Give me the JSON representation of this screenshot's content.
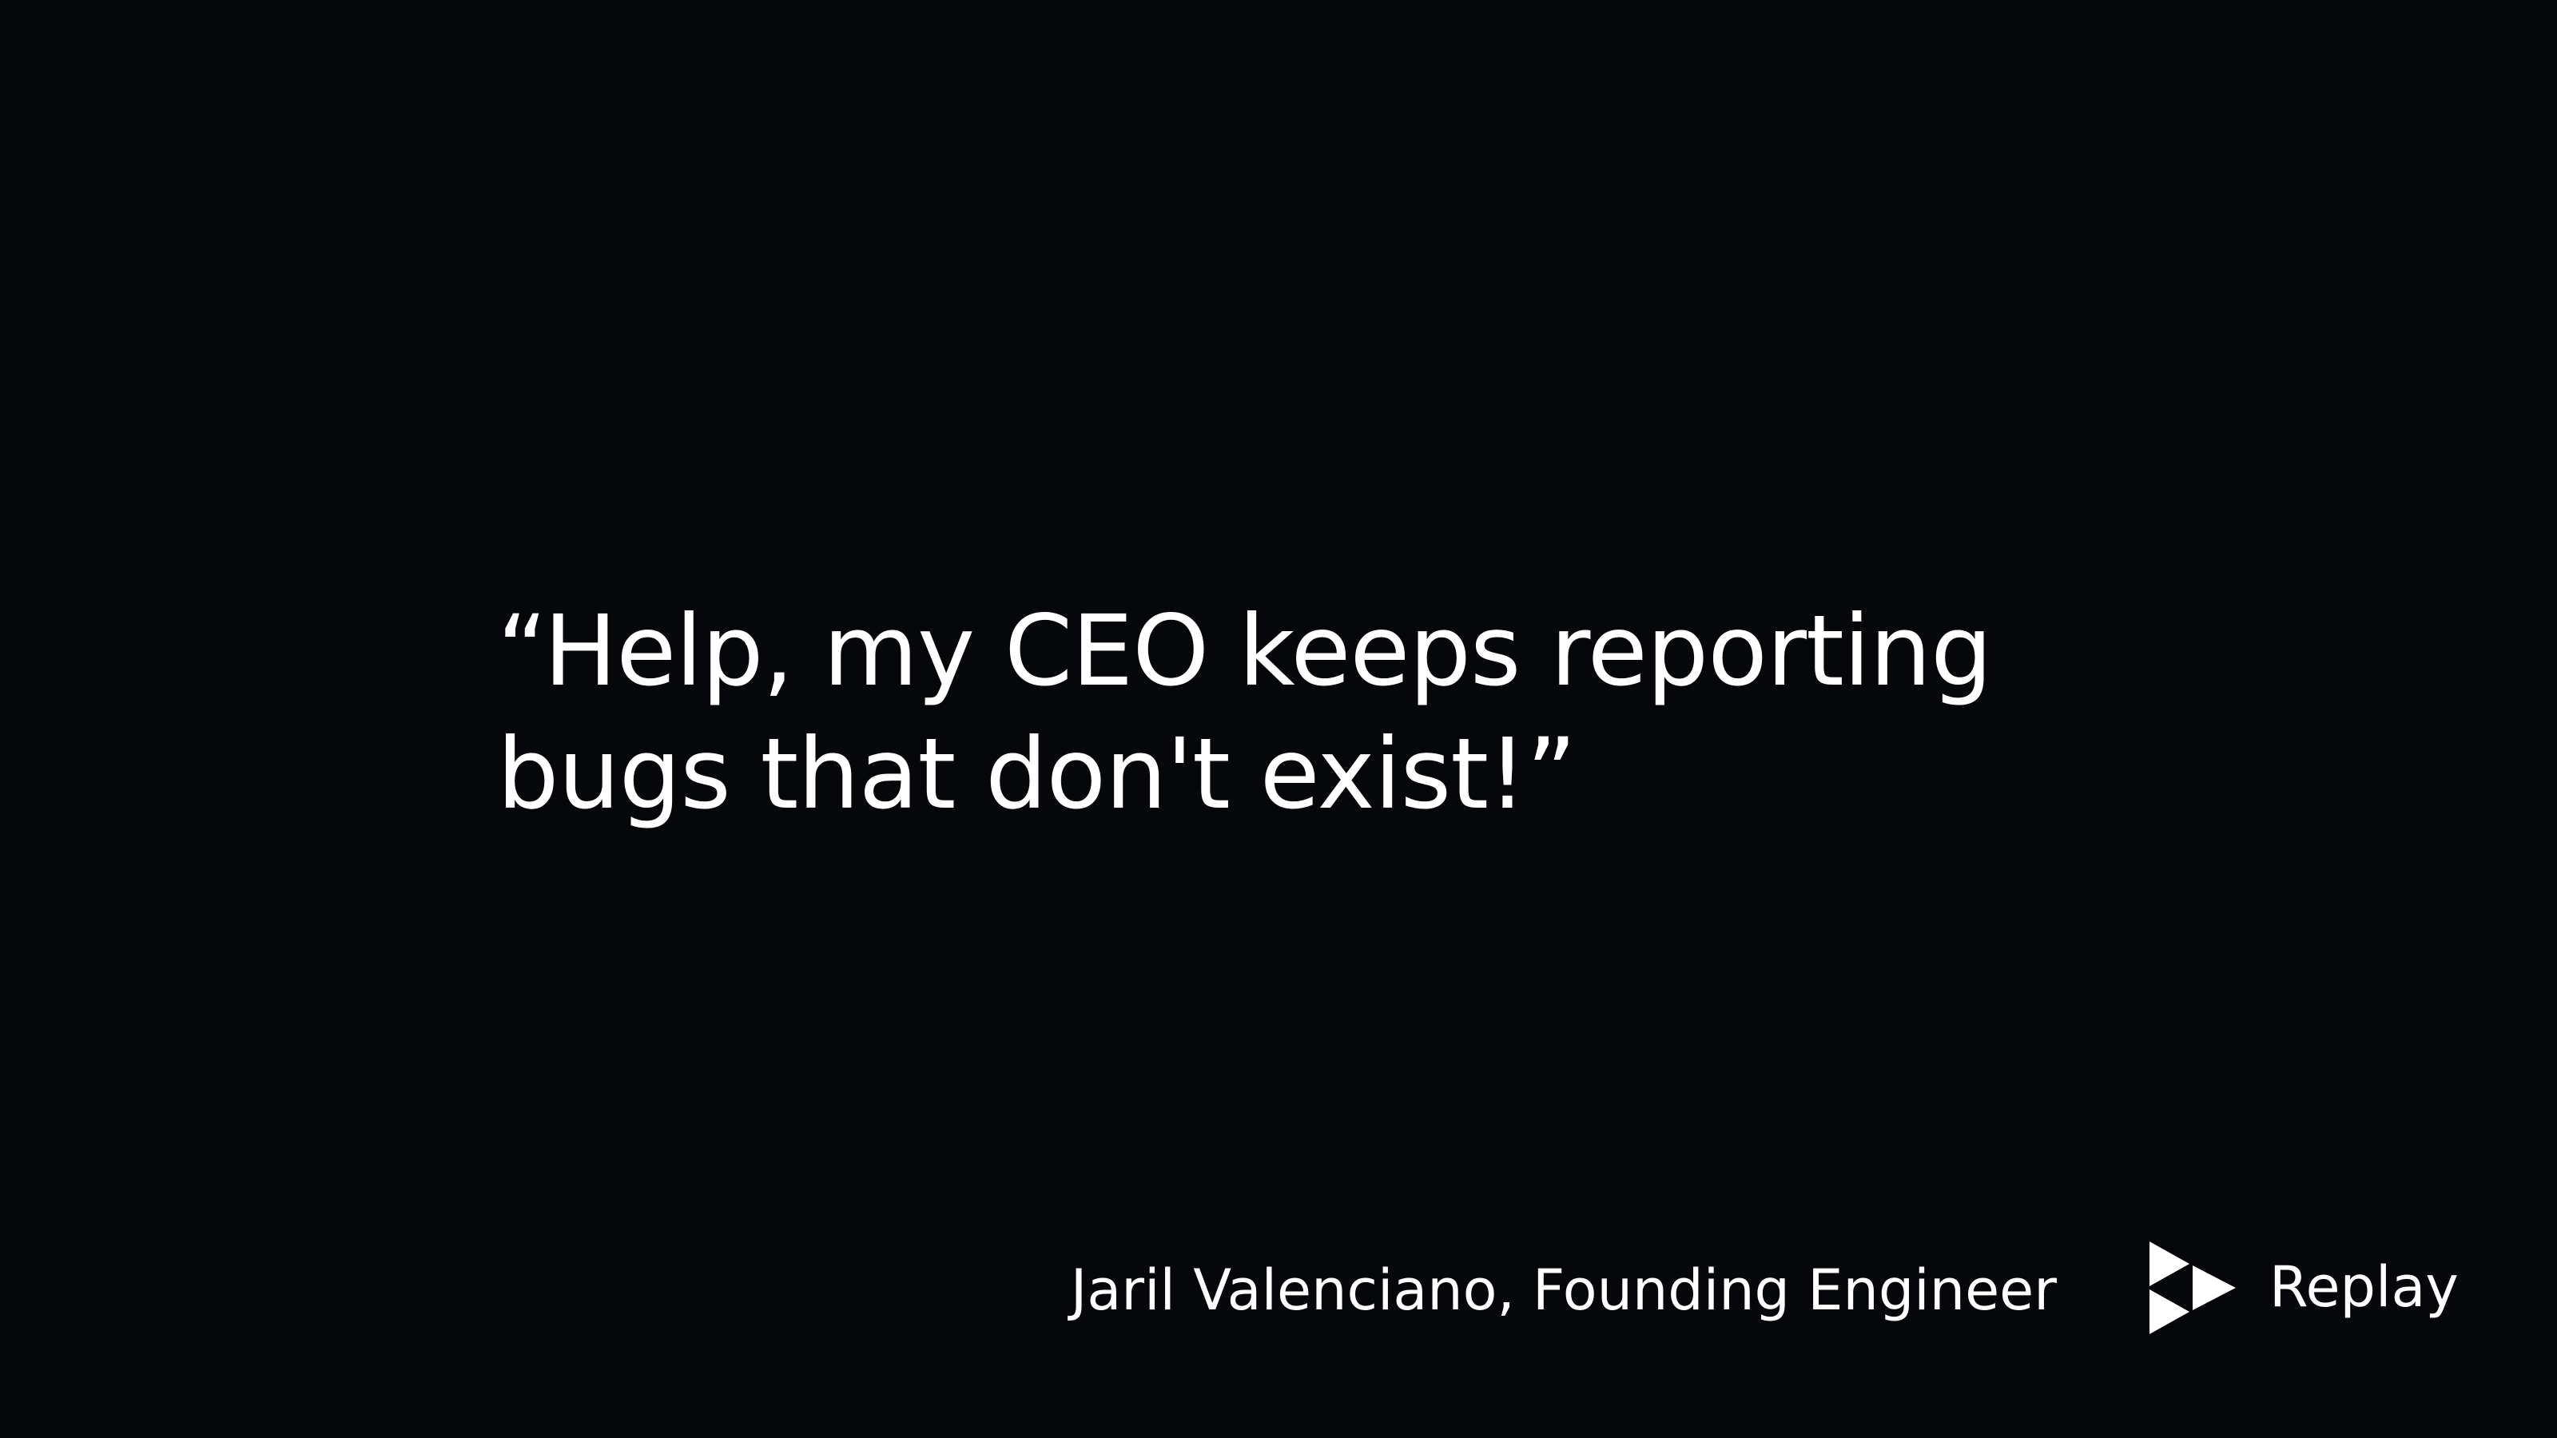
{
  "quote": {
    "line1": "“Help, my CEO keeps reporting",
    "line2": "bugs that don't exist!”"
  },
  "attribution": "Jaril Valenciano, Founding Engineer",
  "brand": {
    "name": "Replay",
    "icon": "replay-logo-icon"
  },
  "colors": {
    "background": "#06070b",
    "text": "#ffffff"
  }
}
